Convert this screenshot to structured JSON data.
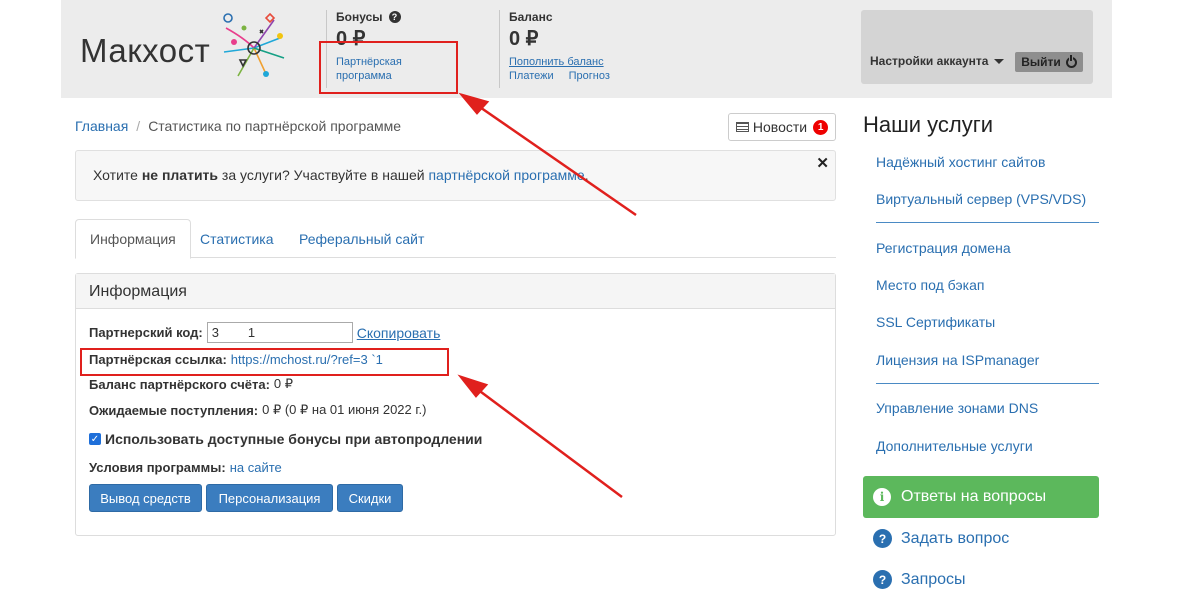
{
  "brand": {
    "logo_text": "Макхост"
  },
  "header": {
    "bonuses": {
      "title": "Бонусы",
      "value": "0 ₽",
      "link": "Партнёрская\nпрограмма"
    },
    "balance": {
      "title": "Баланс",
      "value": "0 ₽",
      "topup": "Пополнить баланс",
      "payments": "Платежи",
      "forecast": "Прогноз"
    },
    "account": {
      "settings": "Настройки аккаунта",
      "logout": "Выйти"
    }
  },
  "breadcrumb": {
    "home": "Главная",
    "current": "Статистика по партнёрской программе"
  },
  "news": {
    "label": "Новости",
    "count": "1"
  },
  "promo": {
    "pre": "Хотите ",
    "bold": "не платить",
    "mid": " за услуги? Участвуйте в нашей ",
    "link": "партнёрской программе",
    "post": ".",
    "close": "✕"
  },
  "tabs": [
    {
      "label": "Информация",
      "active": true
    },
    {
      "label": "Статистика",
      "active": false
    },
    {
      "label": "Реферальный сайт",
      "active": false
    }
  ],
  "panel": {
    "title": "Информация",
    "code_label": "Партнерский код:",
    "code_value": "3        1",
    "copy": "Скопировать",
    "link_label": "Партнёрская ссылка:",
    "link_value": "https://mchost.ru/?ref=3       `1",
    "balance_label": "Баланс партнёрского счёта:",
    "balance_value": "0 ₽",
    "expected_label": "Ожидаемые поступления:",
    "expected_value": "0 ₽ (0 ₽ на 01 июня 2022 г.)",
    "autorenew": "Использовать доступные бонусы при автопродлении",
    "terms_label": "Условия программы:",
    "terms_link": "на сайте",
    "btn_withdraw": "Вывод средств",
    "btn_personal": "Персонализация",
    "btn_discounts": "Скидки"
  },
  "sidebar": {
    "title": "Наши услуги",
    "items": [
      "Надёжный хостинг сайтов",
      "Виртуальный сервер (VPS/VDS)",
      "Регистрация домена",
      "Место под бэкап",
      "SSL Сертификаты",
      "Лицензия на ISPmanager",
      "Управление зонами DNS",
      "Дополнительные услуги"
    ],
    "faq": "Ответы на вопросы",
    "ask": "Задать вопрос",
    "requests": "Запросы"
  },
  "colors": {
    "accent": "#2a6fb0",
    "button": "#3b7dbf",
    "success": "#5cb85c",
    "highlight": "#e0201d"
  }
}
